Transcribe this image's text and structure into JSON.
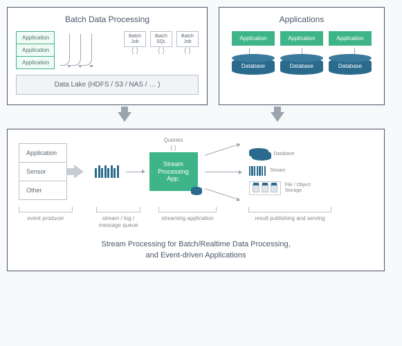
{
  "batch": {
    "title": "Batch Data Processing",
    "apps": [
      "Application",
      "Application",
      "Application"
    ],
    "jobs": [
      {
        "line1": "Batch",
        "line2": "Job"
      },
      {
        "line1": "Batch",
        "line2": "SQL"
      },
      {
        "line1": "Batch",
        "line2": "Job"
      }
    ],
    "data_lake": "Data Lake (HDFS / S3 / NAS / … )"
  },
  "applications": {
    "title": "Applications",
    "apps": [
      "Application",
      "Application",
      "Application"
    ],
    "dbs": [
      "Database",
      "Database",
      "Database"
    ]
  },
  "stream": {
    "queries_label": "Queries",
    "producers": [
      "Application",
      "Sensor",
      "Other"
    ],
    "app_label": "Stream Processing App.",
    "sinks": {
      "database": "Database",
      "stream": "Stream",
      "file": "File / Object Storage"
    },
    "captions": {
      "producer": "event producer",
      "queue": "stream / log / message queue",
      "app": "streaming application",
      "result": "result publishing and serving"
    },
    "title_line1": "Stream Processing for Batch/Realtime Data Processing,",
    "title_line2": "and Event-driven Applications"
  }
}
